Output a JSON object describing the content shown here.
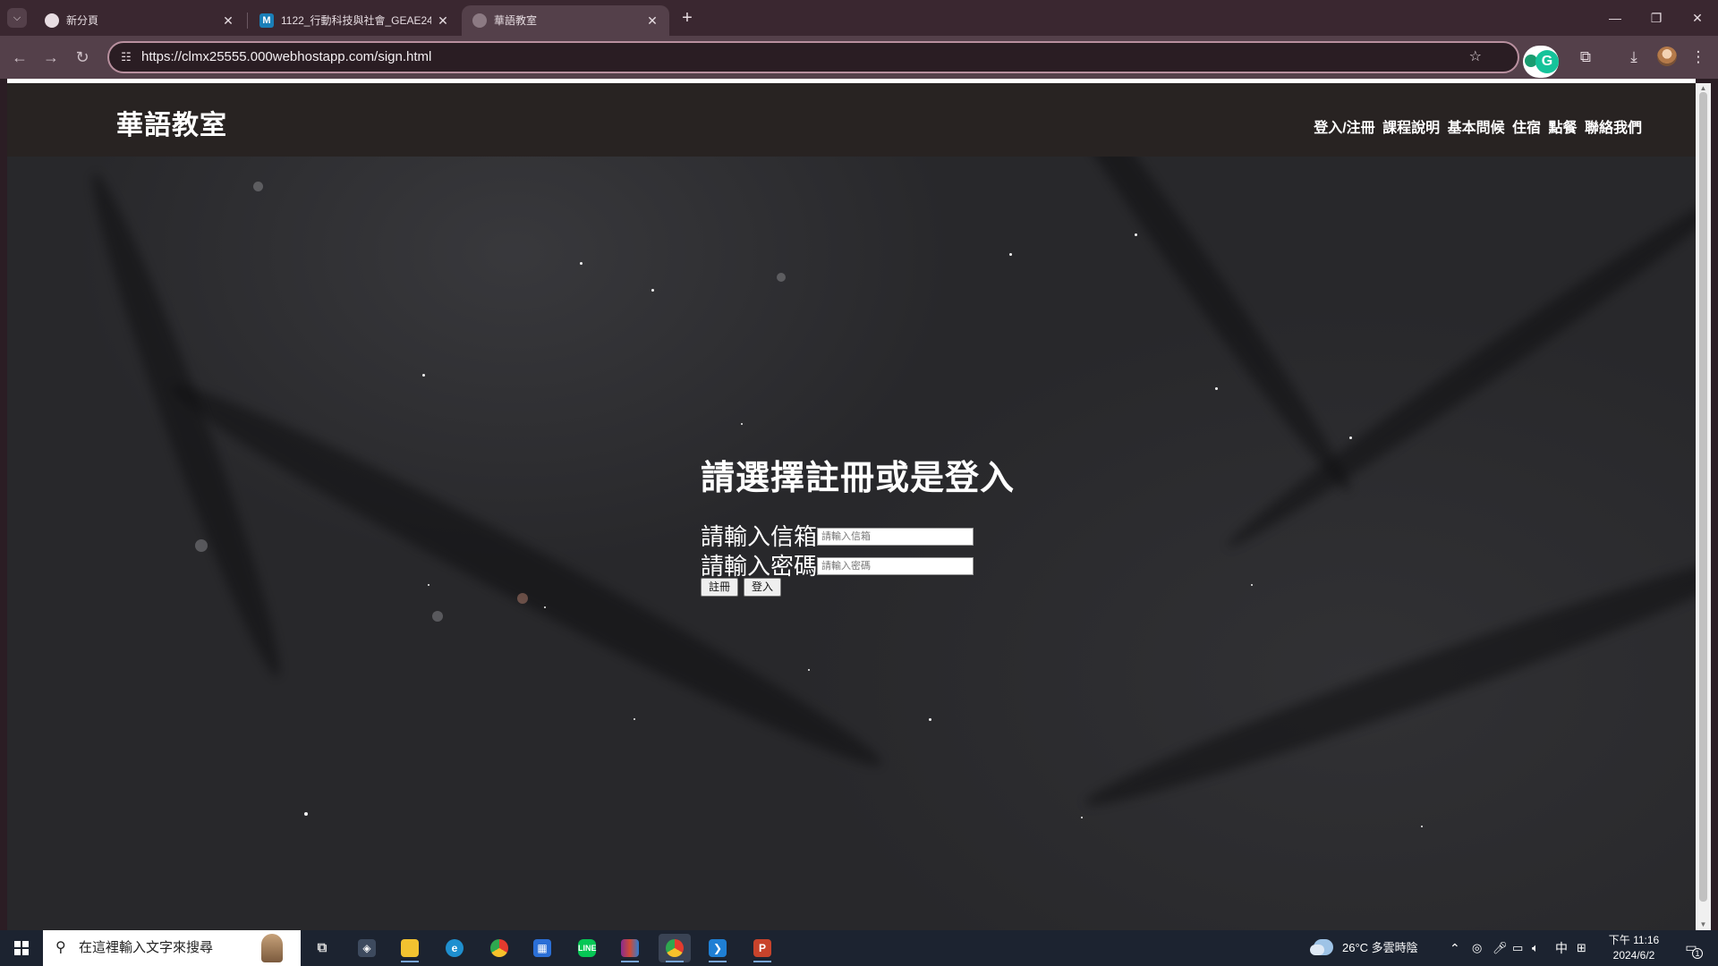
{
  "browser": {
    "tabs": [
      {
        "title": "新分頁",
        "active": false
      },
      {
        "title": "1122_行動科技與社會_GEAE24",
        "active": false
      },
      {
        "title": "華語教室",
        "active": true
      }
    ],
    "url": "https://clmx25555.000webhostapp.com/sign.html"
  },
  "site": {
    "logo": "華語教室",
    "nav": [
      "登入/注冊",
      "課程說明",
      "基本問候",
      "住宿",
      "點餐",
      "聯絡我們"
    ]
  },
  "form": {
    "title": "請選擇註冊或是登入",
    "email_label": "請輸入信箱",
    "email_placeholder": "請輸入信箱",
    "password_label": "請輸入密碼",
    "password_placeholder": "請輸入密碼",
    "register_button": "註冊",
    "login_button": "登入"
  },
  "taskbar": {
    "search_placeholder": "在這裡輸入文字來搜尋",
    "weather": "26°C 多雲時陰",
    "ime": "中",
    "time": "下午 11:16",
    "date": "2024/6/2",
    "notification_count": "1"
  },
  "colors": {
    "chrome_tabbar": "#3a2730",
    "chrome_toolbar": "#54404a",
    "page_background": "#28282b",
    "header_background": "#282322",
    "taskbar": "#1c2330"
  }
}
